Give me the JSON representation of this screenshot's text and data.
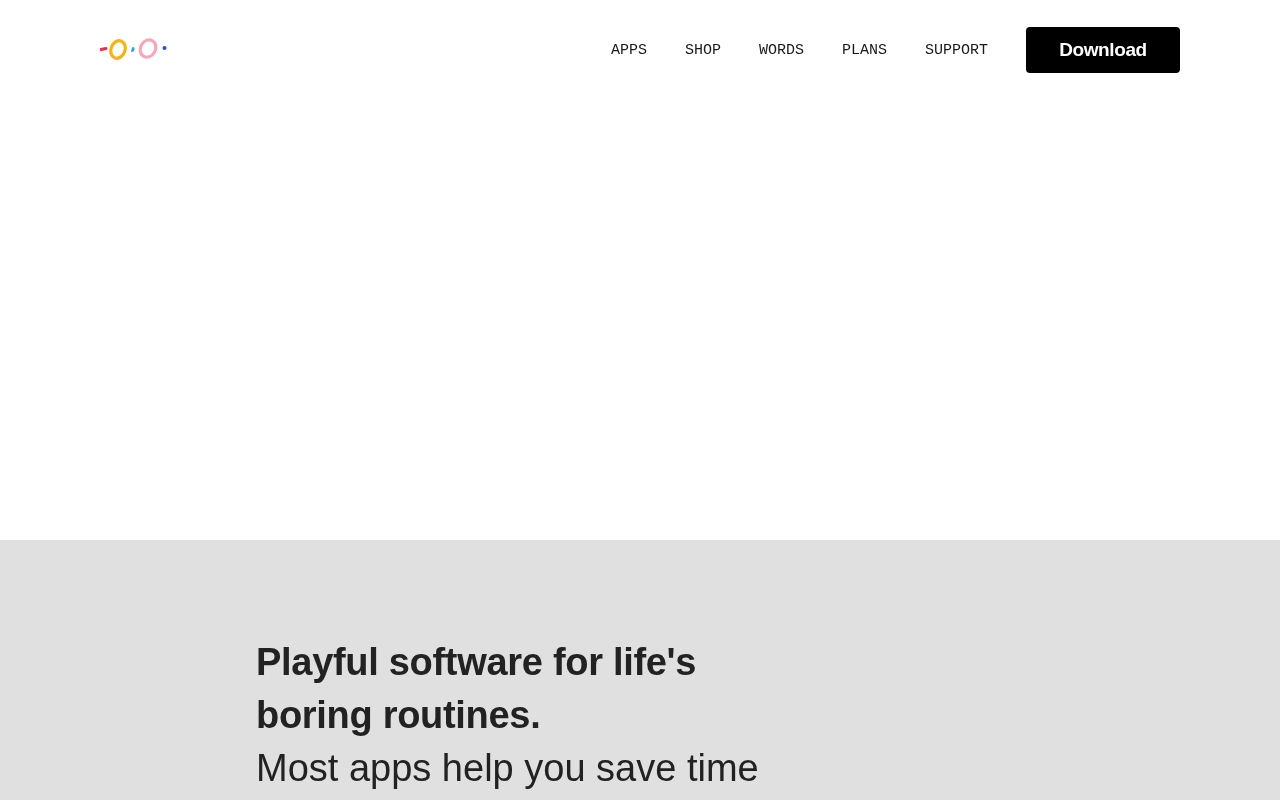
{
  "header": {
    "nav": [
      {
        "label": "APPS"
      },
      {
        "label": "SHOP"
      },
      {
        "label": "WORDS"
      },
      {
        "label": "PLANS"
      },
      {
        "label": "SUPPORT"
      }
    ],
    "cta": {
      "label": "Download"
    }
  },
  "hero": {
    "heading": "Playful software for life's boring routines.",
    "subheading": "Most apps help you save time"
  }
}
